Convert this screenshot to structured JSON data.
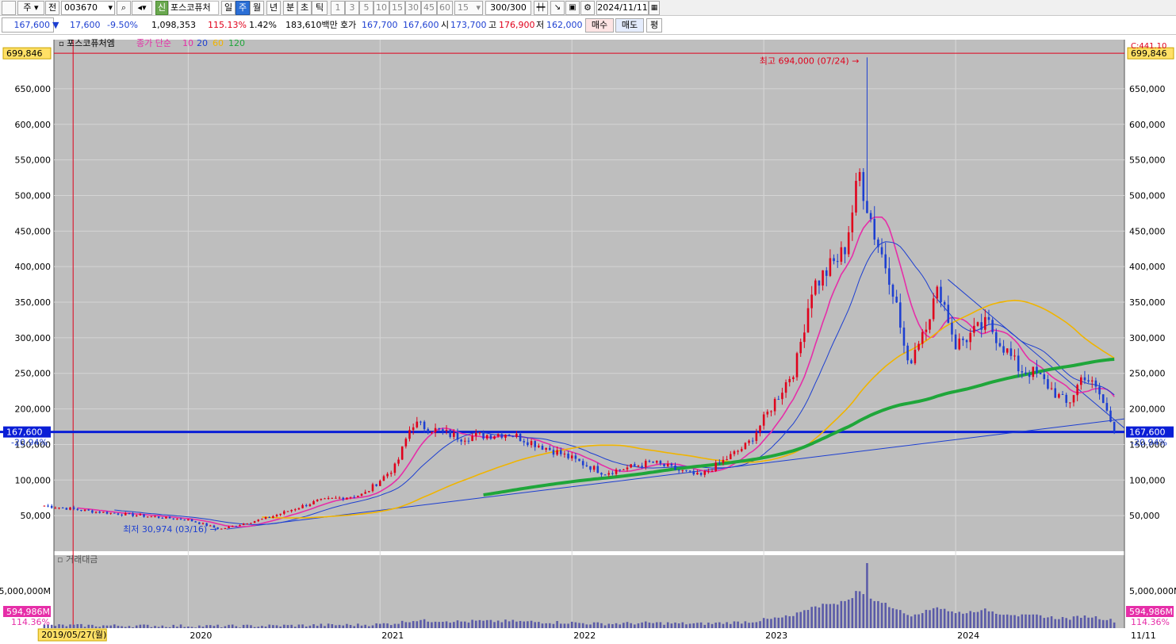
{
  "toolbar": {
    "market_type": "주",
    "prev_label": "전",
    "stock_code": "003670",
    "new_label": "신",
    "stock_name": "포스코퓨처",
    "period_tabs": [
      "일",
      "주",
      "월",
      "년",
      "분",
      "초",
      "틱"
    ],
    "selected_period": "주",
    "interval_options": [
      "1",
      "3",
      "5",
      "10",
      "15",
      "30",
      "45",
      "60"
    ],
    "interval_value": "15",
    "count_display": "300/300",
    "date_value": "2024/11/11"
  },
  "quote": {
    "price": "167,600",
    "change": "17,600",
    "change_pct": "-9.50%",
    "volume": "1,098,353",
    "volume_ratio": "115.13%",
    "turnover": "1.42%",
    "amount": "183,610백만",
    "ask_label": "호가",
    "ask": "167,700",
    "bid": "167,600",
    "open_label": "시",
    "open": "173,700",
    "high_label": "고",
    "high": "176,900",
    "low_label": "저",
    "low": "162,000",
    "buy_button": "매수",
    "sell_button": "매도",
    "eval_button": "평"
  },
  "colors": {
    "price_bg": "#bebebe",
    "up": "#e0001b",
    "down": "#1d3fd1",
    "ma10": "#e62ea8",
    "ma20": "#1d3fd1",
    "ma60": "#f0b400",
    "ma120": "#1fa63a",
    "volume": "#5a5aa8"
  },
  "chart_data": {
    "type": "candlestick",
    "legend": {
      "name": "포스코퓨처엠",
      "ma_label": "종가 단순",
      "ma_periods": [
        "10",
        "20",
        "60",
        "120"
      ]
    },
    "y_ticks": [
      "650,000",
      "600,000",
      "550,000",
      "500,000",
      "450,000",
      "400,000",
      "350,000",
      "300,000",
      "250,000",
      "200,000",
      "150,000",
      "100,000",
      "50,000"
    ],
    "y_range": [
      0,
      719000
    ],
    "top_marker": "699,846",
    "right_top_label": "C:441.10",
    "current_price_tag": "167,600",
    "current_pct_tag": "-20.94%",
    "x_labels": [
      "2020",
      "2021",
      "2022",
      "2023",
      "2024"
    ],
    "left_x_partial": "20",
    "right_x_label": "11/11",
    "crosshair_date": "2019/05/27(월)",
    "annotations": {
      "high": "최고 694,000 (07/24)",
      "low": "최저 30,974 (03/16)"
    },
    "price_series": [
      [
        "2019-04",
        64000
      ],
      [
        "2019-07",
        56000
      ],
      [
        "2019-10",
        50000
      ],
      [
        "2020-01",
        44000
      ],
      [
        "2020-03",
        31000
      ],
      [
        "2020-06",
        47000
      ],
      [
        "2020-09",
        70000
      ],
      [
        "2020-12",
        80000
      ],
      [
        "2021-02",
        120000
      ],
      [
        "2021-03",
        180000
      ],
      [
        "2021-06",
        160000
      ],
      [
        "2021-09",
        166000
      ],
      [
        "2021-12",
        140000
      ],
      [
        "2022-03",
        110000
      ],
      [
        "2022-06",
        125000
      ],
      [
        "2022-09",
        105000
      ],
      [
        "2022-12",
        150000
      ],
      [
        "2023-01",
        185000
      ],
      [
        "2023-03",
        260000
      ],
      [
        "2023-04",
        370000
      ],
      [
        "2023-06",
        420000
      ],
      [
        "2023-07",
        530000
      ],
      [
        "2023-08",
        440000
      ],
      [
        "2023-09",
        380000
      ],
      [
        "2023-10",
        260000
      ],
      [
        "2023-12",
        370000
      ],
      [
        "2024-01",
        290000
      ],
      [
        "2024-03",
        320000
      ],
      [
        "2024-05",
        255000
      ],
      [
        "2024-06",
        250000
      ],
      [
        "2024-08",
        205000
      ],
      [
        "2024-09",
        250000
      ],
      [
        "2024-10",
        220000
      ],
      [
        "2024-11",
        167600
      ]
    ],
    "volume_panel": {
      "label": "거래대금",
      "tick": "5,000,000M",
      "current": "594,986M",
      "pct": "114.36%"
    }
  }
}
